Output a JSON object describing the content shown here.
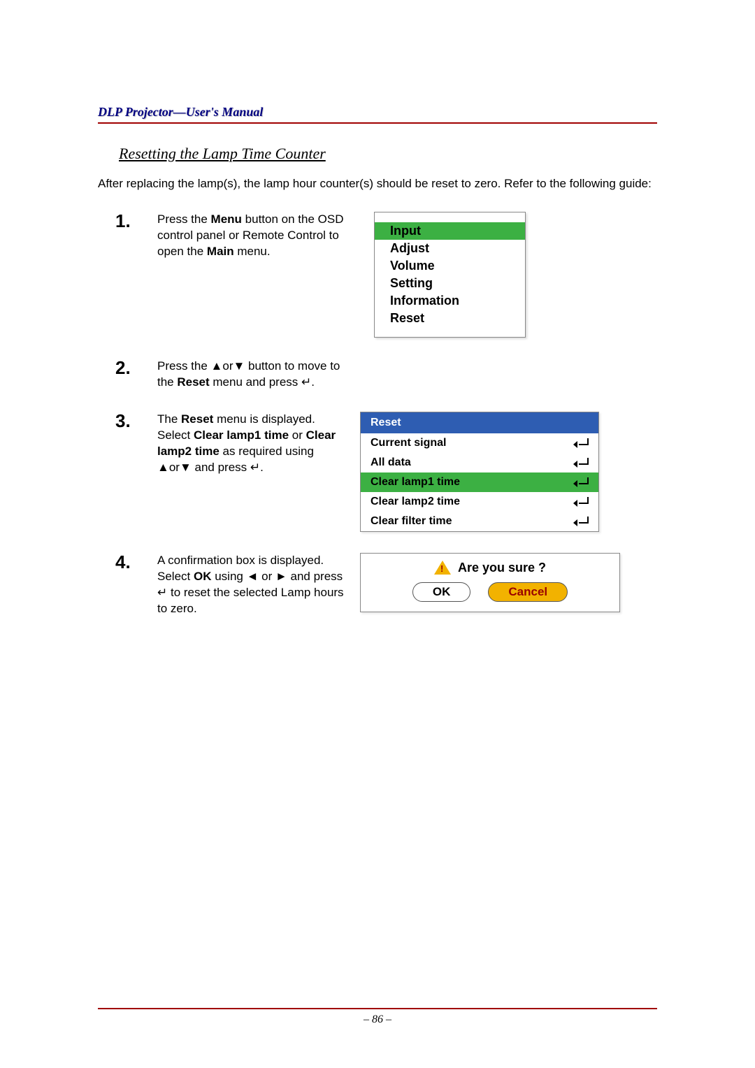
{
  "header": "DLP Projector—User's Manual",
  "sectionTitle": "Resetting the Lamp Time Counter",
  "intro": "After replacing the lamp(s), the lamp hour counter(s) should be reset to zero. Refer to the following guide:",
  "steps": [
    {
      "num": "1.",
      "segs": [
        {
          "t": "Press the "
        },
        {
          "t": "Menu",
          "b": true
        },
        {
          "t": " button on the OSD control panel or Remote Control to open the "
        },
        {
          "t": "Main",
          "b": true
        },
        {
          "t": " menu."
        }
      ]
    },
    {
      "num": "2.",
      "segs": [
        {
          "t": "Press the ▲or▼ button to move to the "
        },
        {
          "t": "Reset",
          "b": true
        },
        {
          "t": " menu and press ↵."
        }
      ]
    },
    {
      "num": "3.",
      "segs": [
        {
          "t": "The "
        },
        {
          "t": "Reset",
          "b": true
        },
        {
          "t": " menu is displayed. Select "
        },
        {
          "t": "Clear lamp1 time",
          "b": true
        },
        {
          "t": " or "
        },
        {
          "t": "Clear lamp2 time",
          "b": true
        },
        {
          "t": " as required using ▲or▼ and press ↵."
        }
      ]
    },
    {
      "num": "4.",
      "segs": [
        {
          "t": "A confirmation box is displayed. Select "
        },
        {
          "t": "OK",
          "b": true
        },
        {
          "t": " using ◄ or ► and press ↵ to reset the selected Lamp hours to zero."
        }
      ]
    }
  ],
  "mainMenu": {
    "items": [
      "Input",
      "Adjust",
      "Volume",
      "Setting",
      "Information",
      "Reset"
    ],
    "selectedIndex": 0
  },
  "resetMenu": {
    "title": "Reset",
    "items": [
      "Current signal",
      "All data",
      "Clear lamp1 time",
      "Clear lamp2 time",
      "Clear filter time"
    ],
    "selectedIndex": 2
  },
  "confirm": {
    "question": "Are you sure ?",
    "ok": "OK",
    "cancel": "Cancel"
  },
  "pageNumber": "– 86 –"
}
